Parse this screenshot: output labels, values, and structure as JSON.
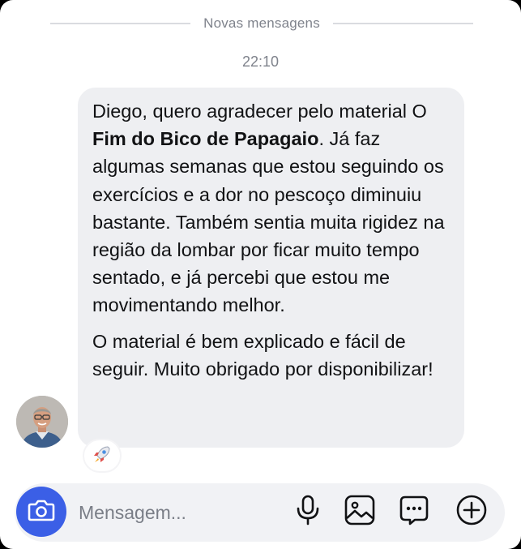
{
  "divider": {
    "label": "Novas mensagens"
  },
  "timestamp": "22:10",
  "message": {
    "p1_intro": "Diego, quero agradecer pelo material O ",
    "p1_title": "Fim do Bico de Papagaio",
    "p1_rest": ". Já faz algumas semanas que estou seguindo os exercícios e a dor no pescoço diminuiu bastante. Também sentia muita rigidez na região da lombar por ficar muito tempo sentado, e já percebi que estou me movimentando melhor.",
    "p2": "O material é bem explicado e fácil de seguir. Muito obrigado por disponibilizar!"
  },
  "reaction": {
    "emoji": "🚀",
    "icon": "rocket-icon"
  },
  "composer": {
    "placeholder": "Mensagem...",
    "icons": [
      "camera-icon",
      "microphone-icon",
      "image-icon",
      "sticker-icon",
      "plus-circle-icon"
    ]
  },
  "colors": {
    "accent": "#3b5fe6",
    "bubble": "#eeeff2",
    "muted_text": "#7f838c"
  }
}
